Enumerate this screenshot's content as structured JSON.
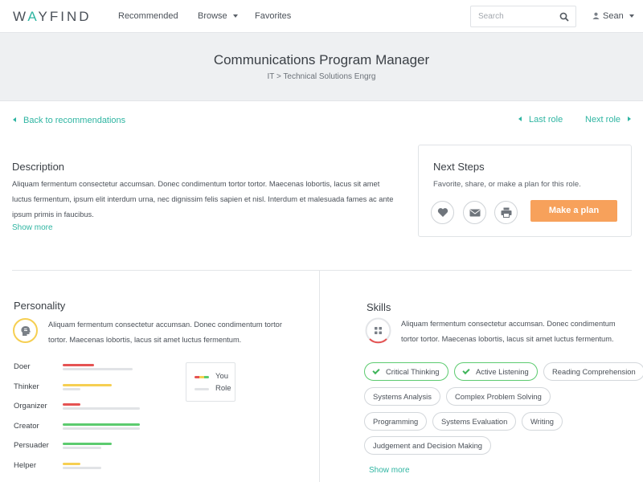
{
  "header": {
    "logo_prefix": "W",
    "logo_accent": "A",
    "logo_suffix": "YFIND",
    "nav": {
      "recommended": "Recommended",
      "browse": "Browse",
      "favorites": "Favorites"
    },
    "search_placeholder": "Search",
    "user_name": "Sean"
  },
  "hero": {
    "title": "Communications Program Manager",
    "breadcrumb": "IT > Technical Solutions Engrg"
  },
  "navigation": {
    "back": "Back to recommendations",
    "last_role": "Last role",
    "next_role": "Next role"
  },
  "description": {
    "title": "Description",
    "text": "Aliquam fermentum consectetur accumsan. Donec condimentum tortor tortor. Maecenas lobortis, lacus sit amet luctus fermentum, ipsum elit interdum urna, nec dignissim felis sapien et nisl. Interdum et malesuada fames ac ante ipsum primis in faucibus.",
    "show_more": "Show more"
  },
  "next_steps": {
    "title": "Next Steps",
    "subtitle": "Favorite, share, or make a plan for this role.",
    "icons": [
      "heart-icon",
      "mail-icon",
      "print-icon"
    ],
    "plan_button": "Make a plan"
  },
  "personality": {
    "title": "Personality",
    "text": "Aliquam fermentum consectetur accumsan. Donec condimentum tortor tortor. Maecenas lobortis, lacus sit amet luctus fermentum.",
    "traits": [
      {
        "label": "Doer",
        "you": 0.45,
        "role": 1.0,
        "color": "#e55353"
      },
      {
        "label": "Thinker",
        "you": 0.7,
        "role": 0.25,
        "color": "#f6cf52"
      },
      {
        "label": "Organizer",
        "you": 0.25,
        "role": 1.1,
        "color": "#e55353"
      },
      {
        "label": "Creator",
        "you": 1.1,
        "role": 1.1,
        "color": "#5ccb6f"
      },
      {
        "label": "Persuader",
        "you": 0.7,
        "role": 0.55,
        "color": "#5ccb6f"
      },
      {
        "label": "Helper",
        "you": 0.25,
        "role": 0.55,
        "color": "#f6cf52"
      }
    ],
    "legend_you": "You",
    "legend_role": "Role"
  },
  "skills": {
    "title": "Skills",
    "text": "Aliquam fermentum consectetur accumsan. Donec condimentum tortor tortor. Maecenas lobortis, lacus sit amet luctus fermentum.",
    "pills": [
      {
        "label": "Critical Thinking",
        "active": true
      },
      {
        "label": "Active Listening",
        "active": true
      },
      {
        "label": "Reading Comprehension",
        "active": false
      },
      {
        "label": "Systems Analysis",
        "active": false
      },
      {
        "label": "Complex Problem Solving",
        "active": false
      },
      {
        "label": "Programming",
        "active": false
      },
      {
        "label": "Systems Evaluation",
        "active": false
      },
      {
        "label": "Writing",
        "active": false
      },
      {
        "label": "Judgement and Decision Making",
        "active": false
      }
    ],
    "show_more": "Show more"
  },
  "colors": {
    "brand": "#2fb5a2",
    "plan_button": "#f7a15b",
    "low": "#e55353",
    "mid": "#f6cf52",
    "high": "#5ccb6f"
  }
}
